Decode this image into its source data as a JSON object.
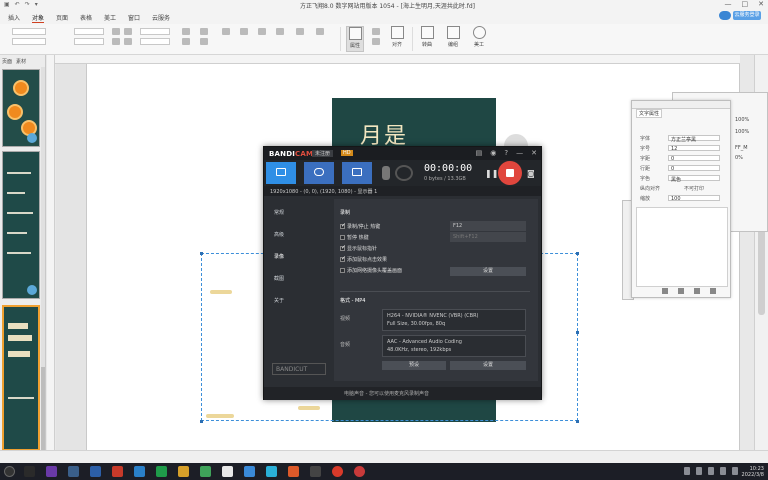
{
  "titlebar": {
    "doc_title": "方正飞翔8.0 数字网站用版本 1054 - [海上生明月,天涯共此时.fd]",
    "window_controls": [
      "—",
      "□",
      "✕"
    ]
  },
  "ribbon": {
    "tabs": [
      "插入",
      "对象",
      "页面",
      "表格",
      "美工",
      "窗口",
      "云服务"
    ],
    "active_tab": "对象",
    "cloud_button": "云服务登录",
    "groups": [
      "属性",
      "对齐",
      "转曲",
      "编组",
      "锁定",
      "阴影",
      "透明",
      "美工"
    ],
    "selected_group": "属性",
    "fields": [
      "0mm",
      "0mm",
      "100%",
      "100%"
    ]
  },
  "left_panel": {
    "tabs": [
      "页面",
      "素材"
    ]
  },
  "bandicam": {
    "logo_left": "BANDI",
    "logo_right": "CAM",
    "edition_tag": "未注册",
    "hd_tag": "HD",
    "resolution_info": "1920x1080 - (0, 0), (1920, 1080) - 显示器 1",
    "timer": "00:00:00",
    "size": "0 bytes / 13.3GB",
    "sidebar": [
      "常规",
      "高级",
      "录像",
      "截图",
      "关于"
    ],
    "active_sidebar": "录像",
    "sidebar_logo": "BANDICUT",
    "record_section": "录制",
    "options": [
      {
        "label": "录制/停止 热键",
        "checked": true
      },
      {
        "label": "暂停 热键",
        "checked": false
      },
      {
        "label": "显示鼠标指针",
        "checked": true
      },
      {
        "label": "添加鼠标点击效果",
        "checked": true
      },
      {
        "label": "添加网络摄像头覆盖画面",
        "checked": false
      }
    ],
    "hotkey_record": "F12",
    "hotkey_pause": "Shift+F12",
    "settings_button": "设置",
    "format_section": "格式 - MP4",
    "video_label": "视频",
    "video_codec": "H264 - NVIDIA® NVENC (VBR) (CBR)",
    "video_detail": "Full Size, 30.00fps, 80q",
    "audio_label": "音频",
    "audio_codec": "AAC - Advanced Audio Coding",
    "audio_detail": "48.0KHz, stereo, 192kbps",
    "preset_button": "预设",
    "settings_button2": "设置",
    "status_text": "电脑声音 - 您可以使用麦克风录制声音"
  },
  "float_panel": {
    "tab": "文字属性",
    "rows": [
      "字体",
      "字号",
      "字距",
      "行距",
      "字色",
      "缩放"
    ],
    "values": [
      "方正兰亭黑",
      "12",
      "0",
      "0",
      "黑色",
      "100"
    ],
    "check1": "纵向对齐",
    "check2": "不可打印"
  },
  "bg_panel": {
    "rows": [
      "100%",
      "100%",
      "FF_M",
      "0%"
    ]
  },
  "taskbar": {
    "time": "10:23",
    "date": "2022/3/8"
  },
  "colors": {
    "bandicam_bg": "#2b2e33",
    "bandicam_accent": "#2f8fe6",
    "record_red": "#e0463d",
    "poster_green": "#1f4744"
  }
}
